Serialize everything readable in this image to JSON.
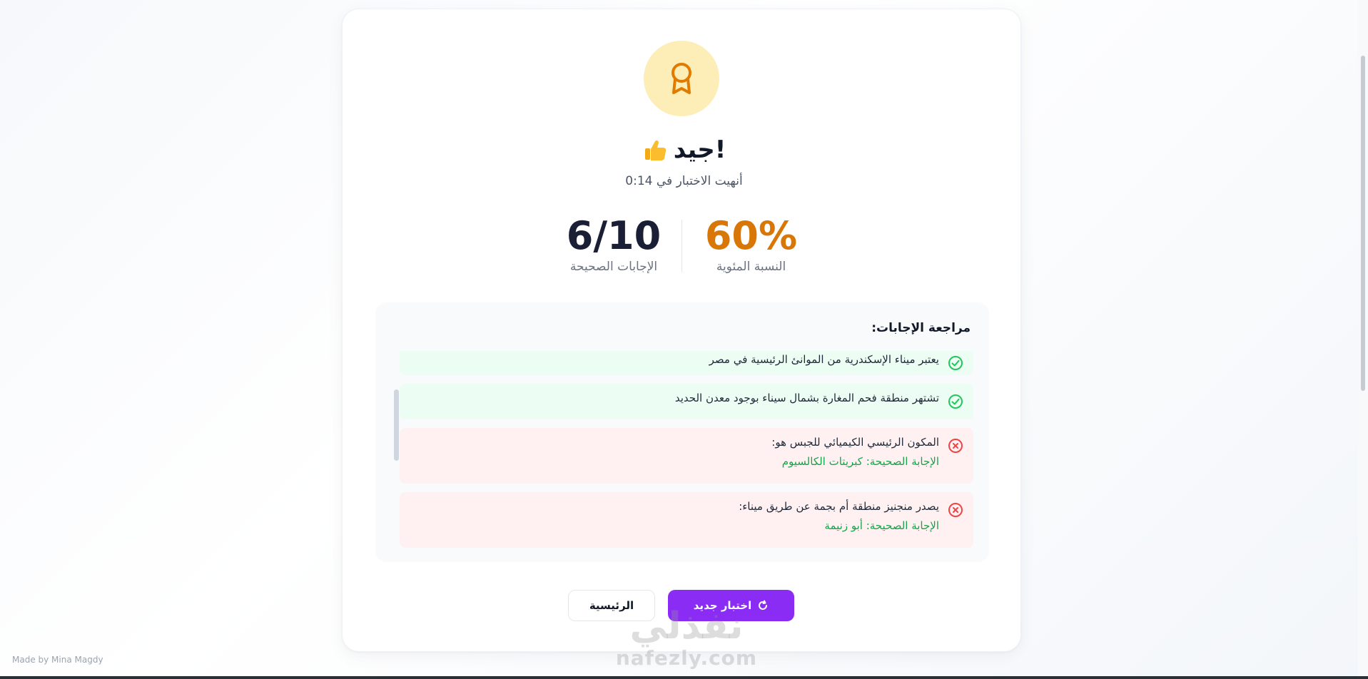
{
  "result": {
    "title": "جيد!",
    "subtitle": "أنهيت الاختبار في 0:14",
    "percentage_value": "60%",
    "percentage_label": "النسبة المئوية",
    "score_value": "6/10",
    "score_label": "الإجابات الصحيحة"
  },
  "review": {
    "heading": "مراجعة الإجابات:",
    "items": [
      {
        "status": "correct",
        "question": "يعتبر ميناء الإسكندرية من الموانئ الرئيسية في مصر"
      },
      {
        "status": "correct",
        "question": "تشتهر منطقة فحم المغارة بشمال سيناء بوجود معدن الحديد"
      },
      {
        "status": "wrong",
        "question": "المكون الرئيسي الكيميائي للجبس هو:",
        "answer": "الإجابة الصحيحة: كبريتات الكالسيوم"
      },
      {
        "status": "wrong",
        "question": "يصدر منجنيز منطقة أم بجمة عن طريق ميناء:",
        "answer": "الإجابة الصحيحة: أبو زنيمة"
      }
    ]
  },
  "buttons": {
    "home_label": "الرئيسية",
    "new_quiz_label": "اختبار جديد"
  },
  "footer": {
    "credit": "Made by Mina Magdy"
  },
  "watermark": {
    "arabic": "نفذلي",
    "latin": "nafezly.com"
  },
  "colors": {
    "accent": "#8b2cf5",
    "percentage": "#d97706",
    "medal_bg": "#fdeeb8",
    "correct_bg": "#ecfdf3",
    "wrong_bg": "#fff1f2",
    "correct_icon": "#22c55e",
    "wrong_icon": "#ef4444",
    "answer_text": "#16a34a"
  },
  "icons": {
    "medal": "award-icon",
    "title_emoji": "thumbs-up-icon",
    "correct": "check-circle-icon",
    "wrong": "x-circle-icon",
    "new_quiz": "refresh-icon"
  }
}
